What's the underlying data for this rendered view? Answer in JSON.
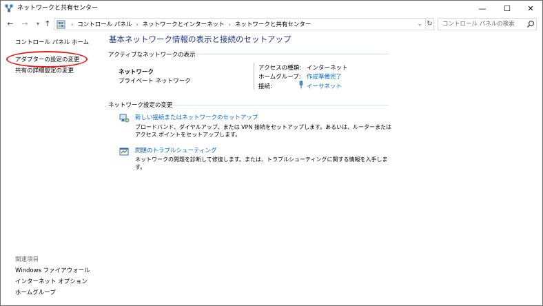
{
  "window": {
    "title": "ネットワークと共有センター",
    "minimize_glyph": "—",
    "maximize_glyph": "☐",
    "close_glyph": "✕"
  },
  "navigation": {
    "back_glyph": "←",
    "forward_glyph": "→",
    "recent_glyph": "▾",
    "up_glyph": "↑",
    "breadcrumbs": [
      "コントロール パネル",
      "ネットワークとインターネット",
      "ネットワークと共有センター"
    ],
    "separator": "›",
    "dropdown_glyph": "⌄",
    "refresh_glyph": "↻"
  },
  "search": {
    "placeholder": "コントロール パネルの検索"
  },
  "sidebar": {
    "links": [
      "コントロール パネル ホーム",
      "アダプターの設定の変更",
      "共有の詳細設定の変更"
    ],
    "related_header": "関連項目",
    "related_links": [
      "Windows ファイアウォール",
      "インターネット オプション",
      "ホームグループ"
    ],
    "highlight_color": "#e02020"
  },
  "main": {
    "title": "基本ネットワーク情報の表示と接続のセットアップ",
    "active_networks_header": "アクティブなネットワークの表示",
    "network": {
      "name": "ネットワーク",
      "type": "プライベート ネットワーク",
      "access_type_label": "アクセスの種類:",
      "access_type_value": "インターネット",
      "homegroup_label": "ホームグループ:",
      "homegroup_value": "作成準備完了",
      "connection_label": "接続:",
      "connection_value": "イーサネット"
    },
    "change_settings_header": "ネットワーク設定の変更",
    "tasks": [
      {
        "link": "新しい接続またはネットワークのセットアップ",
        "description": "ブロードバンド、ダイヤルアップ、または VPN 接続をセットアップします。あるいは、ルーターまたはアクセス ポイントをセットアップします。"
      },
      {
        "link": "問題のトラブルシューティング",
        "description": "ネットワークの問題を診断して修復します。または、トラブルシューティングに関する情報を入手します。"
      }
    ]
  },
  "colors": {
    "title_blue": "#1e3287",
    "link_blue": "#0066cc"
  }
}
